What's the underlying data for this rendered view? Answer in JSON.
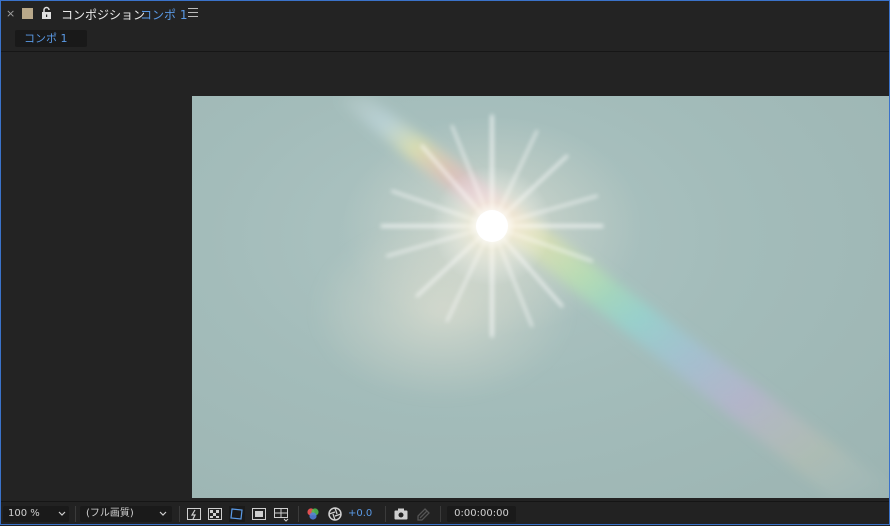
{
  "header": {
    "close_glyph": "×",
    "title": "コンポジション",
    "comp_name": "コンポ 1",
    "swatch_color": "#b9a98a",
    "accent_color": "#5a9ae6"
  },
  "tab": {
    "label": "コンポ 1"
  },
  "toolbar": {
    "zoom": "100 %",
    "resolution": "(フル画質)",
    "exposure": "+0.0",
    "timecode": "0:00:00:00",
    "icons": [
      "fast-preview-icon",
      "transparency-grid-icon",
      "mask-path-visibility-icon",
      "region-of-interest-icon",
      "grid-guides-icon",
      "color-channels-icon",
      "color-management-icon",
      "snapshot-camera-icon",
      "show-snapshot-icon"
    ]
  }
}
